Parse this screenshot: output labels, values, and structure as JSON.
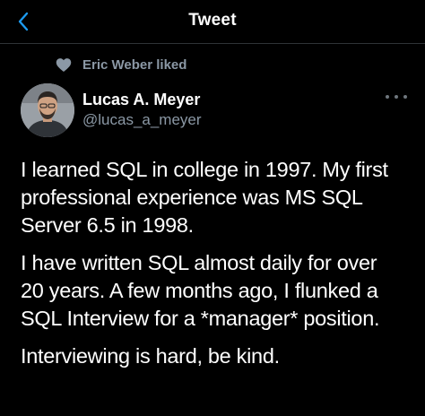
{
  "header": {
    "title": "Tweet",
    "back_icon": "chevron-left-icon"
  },
  "social_context": {
    "icon": "heart-icon",
    "text": "Eric Weber liked"
  },
  "author": {
    "name": "Lucas A. Meyer",
    "handle": "@lucas_a_meyer"
  },
  "tweet": {
    "paragraphs": [
      "I learned SQL in college in 1997. My first\nprofessional experience was MS SQL\nServer 6.5 in 1998.",
      "I have written SQL almost daily for over\n20 years. A few months ago, I flunked a\nSQL Interview for a *manager* position.",
      "Interviewing is hard, be kind."
    ]
  },
  "colors": {
    "background": "#000000",
    "accent": "#1d9bf0",
    "secondary_text": "#8b98a5"
  }
}
